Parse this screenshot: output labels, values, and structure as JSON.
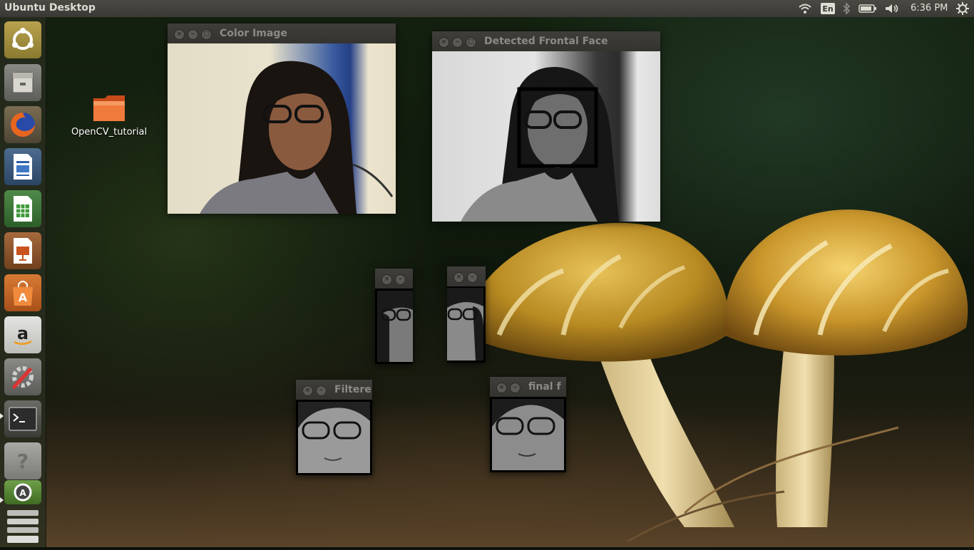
{
  "panel": {
    "title": "Ubuntu Desktop",
    "keyboard_layout": "En",
    "time": "6:36 PM",
    "indicators": [
      "wifi-icon",
      "bluetooth-icon",
      "battery-icon",
      "volume-icon",
      "settings-cog-icon"
    ]
  },
  "launcher": {
    "items": [
      {
        "name": "dash-home",
        "icon": "ubuntu-logo-icon"
      },
      {
        "name": "files",
        "icon": "file-cabinet-icon"
      },
      {
        "name": "firefox",
        "icon": "firefox-icon"
      },
      {
        "name": "libreoffice-writer",
        "icon": "writer-icon"
      },
      {
        "name": "libreoffice-calc",
        "icon": "calc-icon"
      },
      {
        "name": "libreoffice-impress",
        "icon": "impress-icon"
      },
      {
        "name": "software-center",
        "icon": "shopping-bag-icon"
      },
      {
        "name": "amazon",
        "icon": "amazon-icon"
      },
      {
        "name": "system-settings",
        "icon": "settings-wrench-icon"
      },
      {
        "name": "terminal",
        "icon": "terminal-icon"
      },
      {
        "name": "help",
        "icon": "help-icon"
      },
      {
        "name": "software-updater",
        "icon": "updater-icon"
      },
      {
        "name": "workspace-stack",
        "icon": "stack-icon"
      }
    ]
  },
  "desktop": {
    "folder_label": "OpenCV_tutorial"
  },
  "windows": {
    "color_image": {
      "title": "Color Image"
    },
    "detected_face": {
      "title": "Detected Frontal Face"
    },
    "small_left": {
      "title": ""
    },
    "small_right": {
      "title": ""
    },
    "filtered": {
      "title": "Filtere"
    },
    "final": {
      "title": "final f"
    }
  },
  "colors": {
    "panel": "#3a3935",
    "launcher": "#2b2d22",
    "titlebar": "#3c3b37",
    "title_text": "#8c8a84",
    "face_box": "#000000"
  }
}
